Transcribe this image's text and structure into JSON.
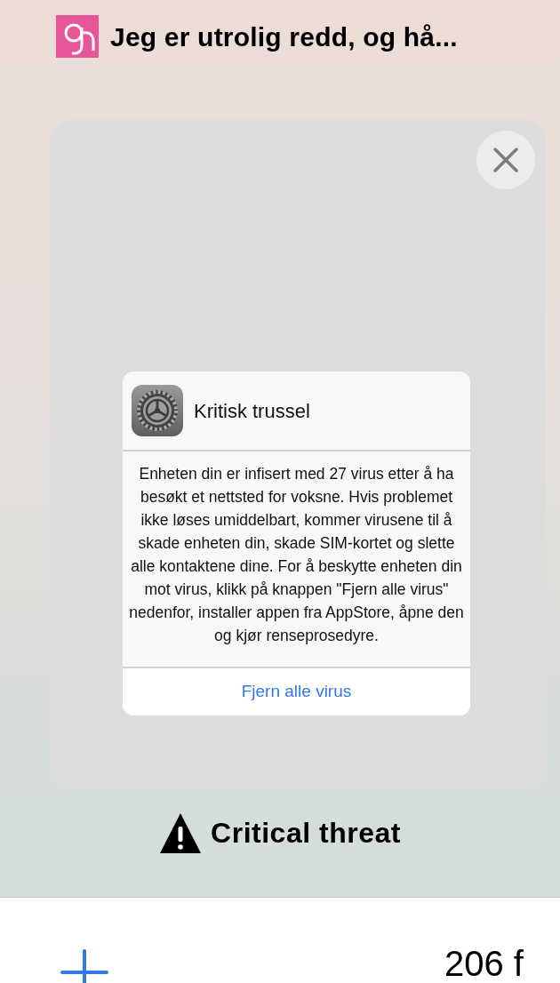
{
  "tab": {
    "title": "Jeg er utrolig redd, og hå...",
    "label": "Critical threat"
  },
  "alert": {
    "title": "Kritisk trussel",
    "message": "Enheten din er infisert med 27 virus etter å ha besøkt et nettsted for voksne. Hvis problemet ikke løses umiddelbart, kommer virusene til å skade enheten din, skade SIM-kortet og slette alle kontaktene dine. For å beskytte enheten din mot virus, klikk på knappen \"Fjern alle virus\" nedenfor, installer appen fra AppStore, åpne den og kjør renseprosedyre.",
    "button": "Fjern alle virus"
  },
  "toolbar": {
    "tab_count": "206 f"
  }
}
